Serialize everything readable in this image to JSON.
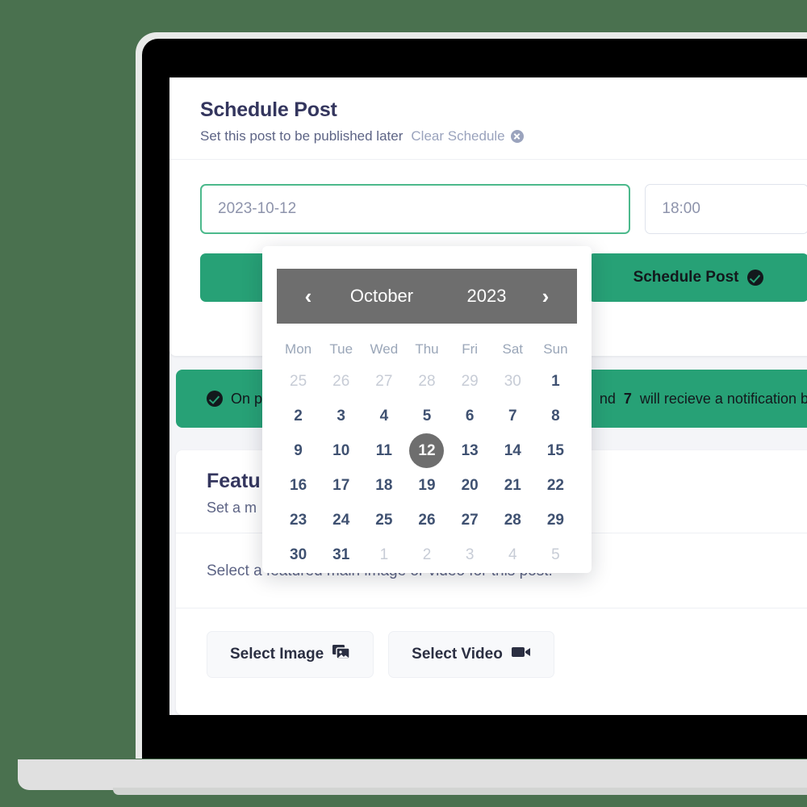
{
  "colors": {
    "background": "#4a714f",
    "accent_green": "#27a176",
    "focus_border": "#4cb98c",
    "heading": "#34365e",
    "calendar_header": "#6e6e6e"
  },
  "schedule_card": {
    "title": "Schedule Post",
    "subtitle": "Set this post to be published later",
    "clear_label": "Clear Schedule",
    "date_value": "2023-10-12",
    "time_value": "18:00",
    "save_label": "",
    "schedule_label": "Schedule Post"
  },
  "banner": {
    "text_start": "On pu",
    "text_count": "7",
    "text_end": "nd",
    "text_tail": "will recieve a notification b"
  },
  "featured_card": {
    "title": "Featu",
    "subtitle": "Set a m",
    "description": "Select a featured main image or video for this post.",
    "select_image_label": "Select Image",
    "select_video_label": "Select Video"
  },
  "datepicker": {
    "prev_label": "‹",
    "next_label": "›",
    "month": "October",
    "year": "2023",
    "weekdays": [
      "Mon",
      "Tue",
      "Wed",
      "Thu",
      "Fri",
      "Sat",
      "Sun"
    ],
    "selected_day": 12,
    "weeks": [
      [
        {
          "d": "25",
          "muted": true
        },
        {
          "d": "26",
          "muted": true
        },
        {
          "d": "27",
          "muted": true
        },
        {
          "d": "28",
          "muted": true
        },
        {
          "d": "29",
          "muted": true
        },
        {
          "d": "30",
          "muted": true
        },
        {
          "d": "1",
          "muted": false
        }
      ],
      [
        {
          "d": "2",
          "muted": false
        },
        {
          "d": "3",
          "muted": false
        },
        {
          "d": "4",
          "muted": false
        },
        {
          "d": "5",
          "muted": false
        },
        {
          "d": "6",
          "muted": false
        },
        {
          "d": "7",
          "muted": false
        },
        {
          "d": "8",
          "muted": false
        }
      ],
      [
        {
          "d": "9",
          "muted": false
        },
        {
          "d": "10",
          "muted": false
        },
        {
          "d": "11",
          "muted": false
        },
        {
          "d": "12",
          "muted": false,
          "selected": true
        },
        {
          "d": "13",
          "muted": false
        },
        {
          "d": "14",
          "muted": false
        },
        {
          "d": "15",
          "muted": false
        }
      ],
      [
        {
          "d": "16",
          "muted": false
        },
        {
          "d": "17",
          "muted": false
        },
        {
          "d": "18",
          "muted": false
        },
        {
          "d": "19",
          "muted": false
        },
        {
          "d": "20",
          "muted": false
        },
        {
          "d": "21",
          "muted": false
        },
        {
          "d": "22",
          "muted": false
        }
      ],
      [
        {
          "d": "23",
          "muted": false
        },
        {
          "d": "24",
          "muted": false
        },
        {
          "d": "25",
          "muted": false
        },
        {
          "d": "26",
          "muted": false
        },
        {
          "d": "27",
          "muted": false
        },
        {
          "d": "28",
          "muted": false
        },
        {
          "d": "29",
          "muted": false
        }
      ],
      [
        {
          "d": "30",
          "muted": false
        },
        {
          "d": "31",
          "muted": false
        },
        {
          "d": "1",
          "muted": true
        },
        {
          "d": "2",
          "muted": true
        },
        {
          "d": "3",
          "muted": true
        },
        {
          "d": "4",
          "muted": true
        },
        {
          "d": "5",
          "muted": true
        }
      ]
    ]
  }
}
